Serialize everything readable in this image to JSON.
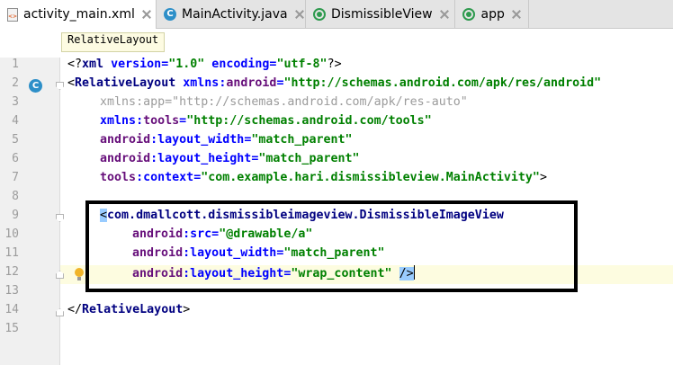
{
  "tabs": [
    {
      "label": "activity_main.xml",
      "icon": "xml-file-icon",
      "active": true
    },
    {
      "label": "MainActivity.java",
      "icon": "class-icon",
      "active": false
    },
    {
      "label": "DismissibleView",
      "icon": "android-module-icon",
      "active": false
    },
    {
      "label": "app",
      "icon": "android-module-icon",
      "active": false
    }
  ],
  "breadcrumb": "RelativeLayout",
  "gutter_icon_line2": "C",
  "line_numbers": [
    "1",
    "2",
    "3",
    "4",
    "5",
    "6",
    "7",
    "8",
    "9",
    "10",
    "11",
    "12",
    "13",
    "14",
    "15"
  ],
  "lines": {
    "l1": {
      "pi_open": "<?",
      "xml": "xml",
      "version_attr": " version=",
      "version_val": "\"1.0\"",
      "enc_attr": " encoding=",
      "enc_val": "\"utf-8\"",
      "pi_close": "?>"
    },
    "l2": {
      "open": "<",
      "tag": "RelativeLayout",
      "ns": " xmlns:",
      "ns_name": "android",
      "eq": "=",
      "val": "\"http://schemas.android.com/apk/res/android\""
    },
    "l3": {
      "attr": "xmlns:app=",
      "val": "\"http://schemas.android.com/apk/res-auto\""
    },
    "l4": {
      "ns": "xmlns:",
      "ns_name": "tools",
      "eq": "=",
      "val": "\"http://schemas.android.com/tools\""
    },
    "l5": {
      "ns": "android",
      "attr": ":layout_width",
      "eq": "=",
      "val": "\"match_parent\""
    },
    "l6": {
      "ns": "android",
      "attr": ":layout_height",
      "eq": "=",
      "val": "\"match_parent\""
    },
    "l7": {
      "ns": "tools",
      "attr": ":context",
      "eq": "=",
      "val": "\"com.example.hari.dismissibleview.MainActivity\"",
      "close": ">"
    },
    "l9": {
      "open": "<",
      "tag": "com.dmallcott.dismissibleimageview.DismissibleImageView"
    },
    "l10": {
      "ns": "android",
      "attr": ":src",
      "eq": "=",
      "val": "\"@drawable/a\""
    },
    "l11": {
      "ns": "android",
      "attr": ":layout_width",
      "eq": "=",
      "val": "\"match_parent\""
    },
    "l12": {
      "ns": "android",
      "attr": ":layout_height",
      "eq": "=",
      "val": "\"wrap_content\"",
      "close": "/>"
    },
    "l14": {
      "open": "</",
      "tag": "RelativeLayout",
      "close": ">"
    }
  }
}
